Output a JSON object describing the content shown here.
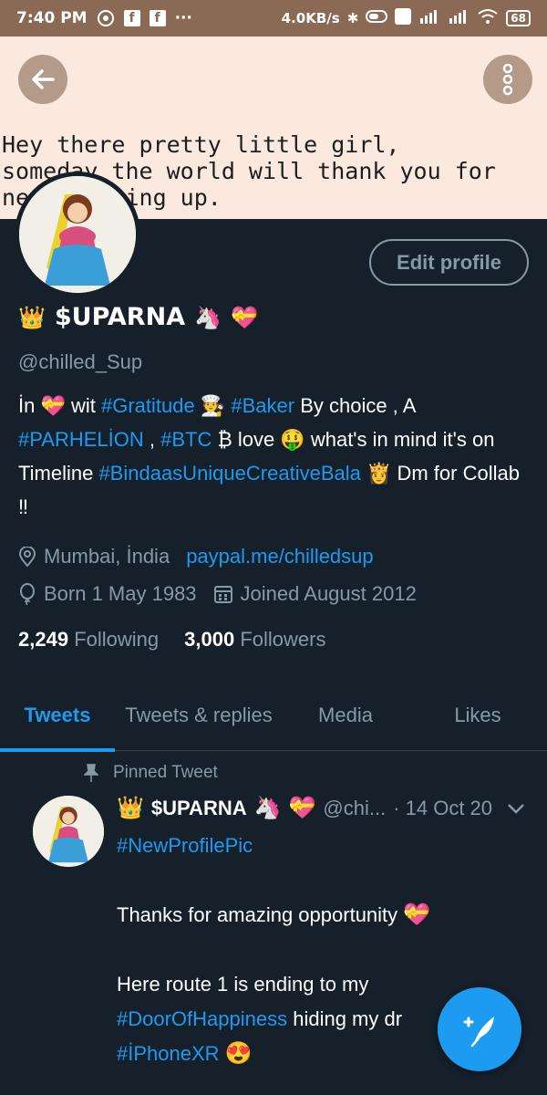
{
  "status_bar": {
    "time": "7:40 PM",
    "speed": "4.0KB/s",
    "battery": "68"
  },
  "banner": {
    "text": "Hey there pretty little girl,\nsomeday the world will thank you for\nnever giving up."
  },
  "profile": {
    "edit_button": "Edit profile",
    "name": "$UPARNA",
    "handle": "@chilled_Sup",
    "bio": [
      {
        "t": "İn ",
        "link": false
      },
      {
        "t": "💝",
        "link": false
      },
      {
        "t": "  wit ",
        "link": false
      },
      {
        "t": "#Gratitude",
        "link": true
      },
      {
        "t": " 🧑‍🍳 ",
        "link": false
      },
      {
        "t": "#Baker",
        "link": true
      },
      {
        "t": " By choice , A ",
        "link": false
      },
      {
        "t": "#PARHELİON",
        "link": true
      },
      {
        "t": " , ",
        "link": false
      },
      {
        "t": "#BTC",
        "link": true
      },
      {
        "t": " ₿  love 🤑  what's in mind it's on Timeline ",
        "link": false
      },
      {
        "t": "#BindaasUniqueCreativeBala",
        "link": true
      },
      {
        "t": "  👸  Dm for Collab ‼",
        "link": false
      }
    ],
    "location": "Mumbai, İndia",
    "website": "paypal.me/chilledsup",
    "born": "Born 1 May 1983",
    "joined": "Joined August 2012",
    "following_count": "2,249",
    "following_label": "Following",
    "followers_count": "3,000",
    "followers_label": "Followers"
  },
  "tabs": [
    "Tweets",
    "Tweets & replies",
    "Media",
    "Likes"
  ],
  "pinned_tweet": {
    "pinned_label": "Pinned Tweet",
    "name": "$UPARNA",
    "handle": "@chi...",
    "date": "· 14 Oct 20",
    "hashtag": "#NewProfilePic",
    "line1": "Thanks for amazing opportunity",
    "line2_start": "Here route 1 is ending to my",
    "hashtag2": "#DoorOfHappiness",
    "line2_end": " hiding my dr",
    "hashtag3": "#İPhoneXR"
  },
  "colors": {
    "background": "#15202b",
    "accent": "#1d9bf0",
    "muted": "#8899a6",
    "status_bar": "#8a6a54",
    "banner": "#fbe9df"
  }
}
